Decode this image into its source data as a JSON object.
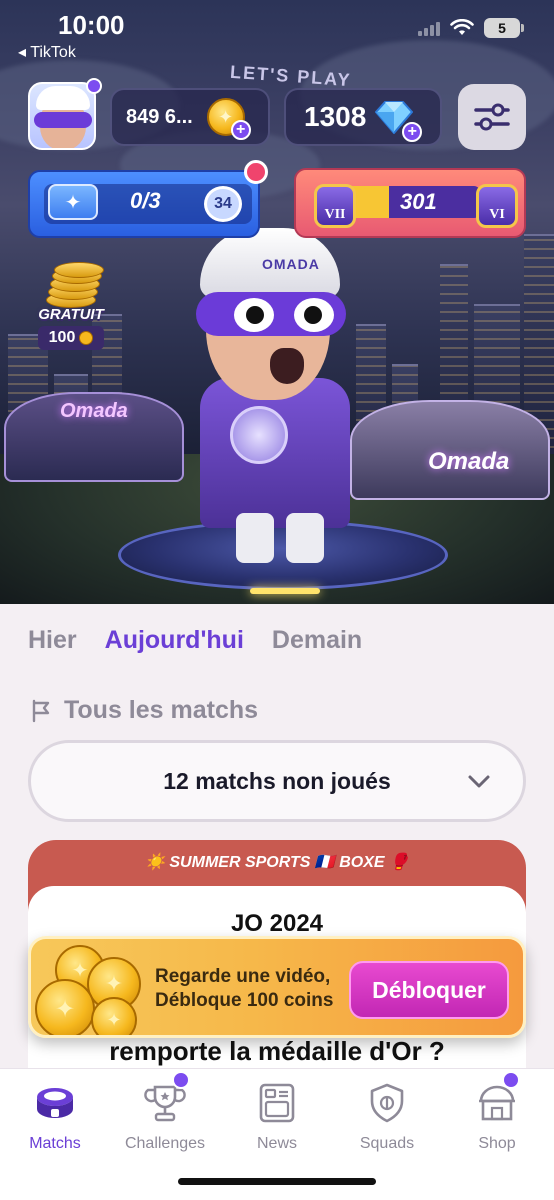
{
  "status_bar": {
    "time": "10:00",
    "back_app": "TikTok",
    "battery": "5"
  },
  "hero": {
    "banner_text": "LET'S PLAY",
    "coins_value": "849 6...",
    "gems_value": "1308",
    "pass_progress": "0/3",
    "pass_level": "34",
    "rank_value": "301",
    "rank_level_left": "VII",
    "rank_level_right": "VI",
    "rank_progress_fraction": 0.35,
    "free_label": "GRATUIT",
    "free_amount": "100",
    "cap_text": "OMADA",
    "stadium_left": "Omada",
    "stadium_right": "Omada",
    "icons": [
      "settings-sliders-icon",
      "coin-icon",
      "gem-icon",
      "ticket-icon",
      "crown-icon"
    ]
  },
  "day_tabs": [
    {
      "label": "Hier",
      "active": false
    },
    {
      "label": "Aujourd'hui",
      "active": true
    },
    {
      "label": "Demain",
      "active": false
    }
  ],
  "filter": {
    "label": "Tous les matchs",
    "icon": "flag-icon"
  },
  "match_select": {
    "value": "12 matchs non joués",
    "icon": "chevron-down-icon"
  },
  "match_card": {
    "header": "☀️ SUMMER SPORTS 🇫🇷 BOXE 🥊",
    "title": "JO 2024",
    "question": "remporte la médaille d'Or ?"
  },
  "unlock_banner": {
    "line1": "Regarde une vidéo,",
    "line2": "Débloque 100 coins",
    "button": "Débloquer"
  },
  "bottom_nav": [
    {
      "label": "Matchs",
      "icon": "stadium-icon",
      "active": true
    },
    {
      "label": "Challenges",
      "icon": "trophy-icon",
      "active": false
    },
    {
      "label": "News",
      "icon": "news-icon",
      "active": false
    },
    {
      "label": "Squads",
      "icon": "shield-icon",
      "active": false
    },
    {
      "label": "Shop",
      "icon": "shop-icon",
      "active": false
    }
  ],
  "colors": {
    "accent": "#6b3fd6",
    "muted": "#8e8a98",
    "card_header": "#c85a50",
    "unlock_button": "#d935c2"
  }
}
